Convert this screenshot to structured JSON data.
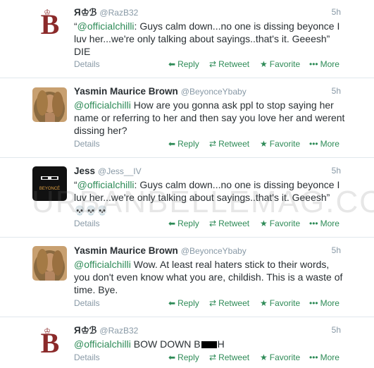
{
  "tweets": [
    {
      "name": "Я♔ℬ",
      "handle": "@RazB32",
      "time": "5h",
      "mention": "",
      "text_prefix": "“",
      "text_mention": "@officialchilli",
      "text": ": Guys calm down...no one is dissing beyonce I luv her...we're only talking about sayings..that's it. Geeesh” DIE",
      "details": "Details",
      "avatar": "b-logo-icon"
    },
    {
      "name": "Yasmin Maurice Brown",
      "handle": "@BeyonceYbaby",
      "time": "5h",
      "text_mention": "@officialchilli",
      "text": " How are you gonna ask ppl to stop saying her name or referring to her and then say you love her and werent dissing her?",
      "details": "Details",
      "avatar": "beyonce-photo"
    },
    {
      "name": "Jess",
      "handle": "@Jess__IV",
      "time": "5h",
      "text_prefix": "“",
      "text_mention": "@officialchilli",
      "text": ": Guys calm down...no one is dissing beyonce I luv her...we're only talking about sayings..that's it. Geeesh”",
      "emoji": "💀💀💀",
      "details": "Details",
      "avatar": "beyonce-album-cover"
    },
    {
      "name": "Yasmin Maurice Brown",
      "handle": "@BeyonceYbaby",
      "time": "5h",
      "text_mention": "@officialchilli",
      "text": " Wow. At least real haters stick to their words, you don't even know what you are, childish. This is a waste of time. Bye.",
      "details": "Details",
      "avatar": "beyonce-photo"
    },
    {
      "name": "Я♔ℬ",
      "handle": "@RazB32",
      "time": "5h",
      "text_mention": "@officialchilli",
      "text_a": " BOW DOWN B",
      "text_b": "H",
      "details": "Details",
      "avatar": "b-logo-icon"
    }
  ],
  "actions": {
    "reply": "Reply",
    "retweet": "Retweet",
    "favorite": "Favorite",
    "more": "More"
  },
  "icons": {
    "reply": "reply-arrow-icon",
    "retweet": "retweet-icon",
    "favorite": "star-icon",
    "more": "ellipsis-icon"
  },
  "album_cover_text": "BEYONCÉ",
  "watermark": "URBANBELLEMAG.COM",
  "colors": {
    "link": "#2e8b57",
    "muted": "#8899a6",
    "logo": "#8b2a2a"
  }
}
